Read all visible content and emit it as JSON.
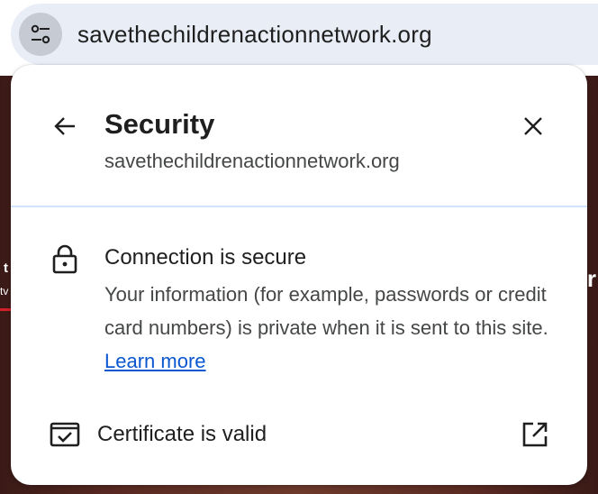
{
  "omnibox": {
    "url": "savethechildrenactionnetwork.org",
    "tune_icon": "tune-icon"
  },
  "background": {
    "fragment_left": "t",
    "fragment_left2": "tv",
    "fragment_right": "r"
  },
  "popup": {
    "title": "Security",
    "subtitle": "savethechildrenactionnetwork.org",
    "back_icon": "arrow-back-icon",
    "close_icon": "close-icon",
    "connection": {
      "icon": "lock-icon",
      "title": "Connection is secure",
      "description": "Your information (for example, passwords or credit card numbers) is private when it is sent to this site.",
      "learn_more": "Learn more"
    },
    "certificate": {
      "icon": "certificate-icon",
      "label": "Certificate is valid",
      "open_icon": "open-in-new-icon"
    }
  },
  "colors": {
    "link": "#0b57d0",
    "omnibox_bg": "#e9eef6",
    "divider": "#d3e3fd"
  }
}
